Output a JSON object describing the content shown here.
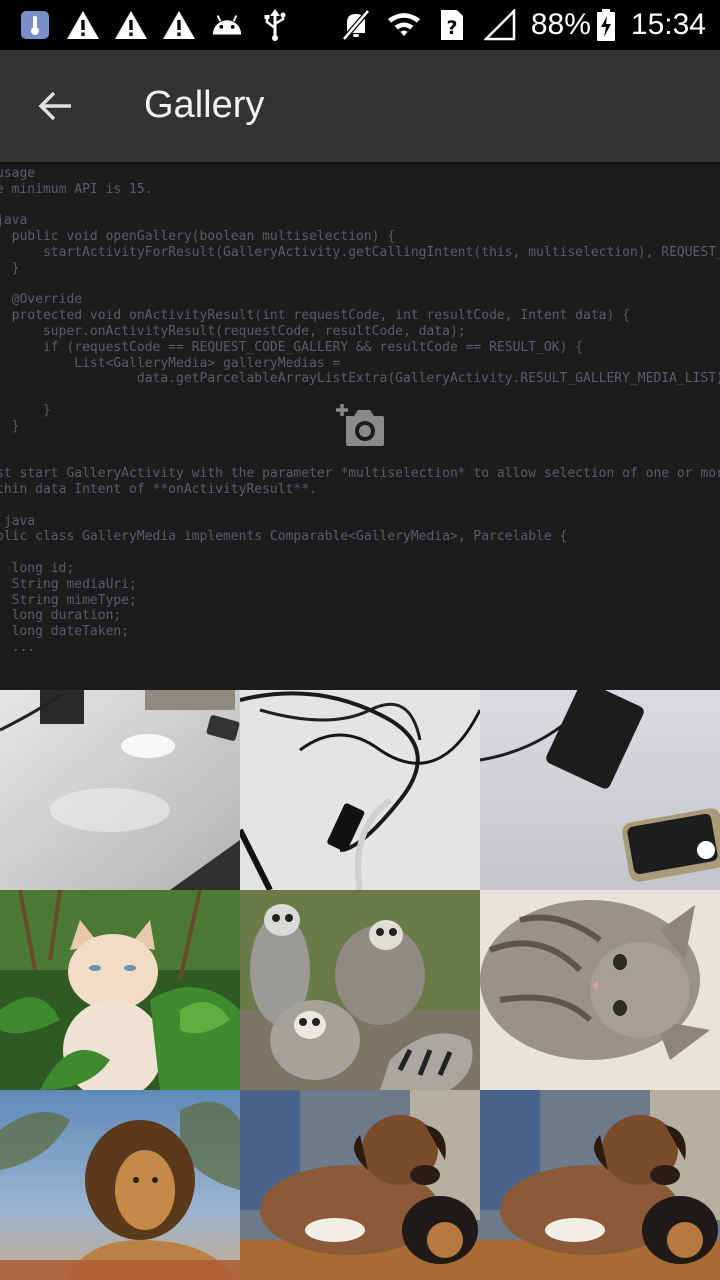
{
  "status_bar": {
    "battery": "88%",
    "time": "15:34",
    "icons": [
      "thermometer-icon",
      "warning-icon",
      "warning-icon",
      "warning-icon",
      "android-icon",
      "usb-icon",
      "mute-icon",
      "wifi-icon",
      "sim-icon",
      "signal-icon",
      "battery-charging-icon"
    ]
  },
  "app_bar": {
    "title": "Gallery",
    "back_icon": "arrow-back-icon"
  },
  "camera_tile": {
    "icon": "add-camera-icon",
    "code_lines": [
      "usage",
      "e minimum API is 15.",
      "",
      "java",
      "  public void openGallery(boolean multiselection) {",
      "      startActivityForResult(GalleryActivity.getCallingIntent(this, multiselection), REQUEST_CO",
      "  }",
      "",
      "  @Override",
      "  protected void onActivityResult(int requestCode, int resultCode, Intent data) {",
      "      super.onActivityResult(requestCode, resultCode, data);",
      "      if (requestCode == REQUEST_CODE_GALLERY && resultCode == RESULT_OK) {",
      "          List<GalleryMedia> galleryMedias =",
      "                  data.getParcelableArrayListExtra(GalleryActivity.RESULT_GALLERY_MEDIA_LIST);",
      "",
      "      }",
      "  }",
      "",
      "",
      "st start GalleryActivity with the parameter *multiselection* to allow selection of one or more i",
      "thin data Intent of **onActivityResult**.",
      "",
      "`java",
      "blic class GalleryMedia implements Comparable<GalleryMedia>, Parcelable {",
      "",
      "  long id;",
      "  String mediaUri;",
      "  String mimeType;",
      "  long duration;",
      "  long dateTaken;",
      "  ...",
      "",
      "`"
    ]
  },
  "media": [
    {
      "subject": "desk-mouse-photo"
    },
    {
      "subject": "usb-cables-photo"
    },
    {
      "subject": "phones-on-desk-photo"
    },
    {
      "subject": "cat-in-plants-photo"
    },
    {
      "subject": "lemurs-photo"
    },
    {
      "subject": "kitten-photo"
    },
    {
      "subject": "lion-photo"
    },
    {
      "subject": "puppies-photo"
    },
    {
      "subject": "puppies-photo"
    }
  ]
}
